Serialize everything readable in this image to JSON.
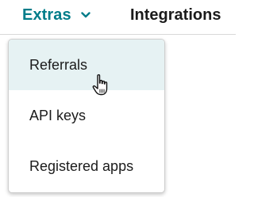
{
  "nav": {
    "extras_label": "Extras",
    "integrations_label": "Integrations",
    "chevron_icon": "chevron-down-icon"
  },
  "dropdown": {
    "items": [
      {
        "label": "Referrals",
        "state": "hover"
      },
      {
        "label": "API keys"
      },
      {
        "label": "Registered apps"
      }
    ]
  },
  "colors": {
    "accent": "#007c89",
    "text": "#1b1b1b",
    "hover_bg": "#e6f2f3",
    "border": "#cfcfcf"
  },
  "cursor_icon": "hand-pointer-icon"
}
